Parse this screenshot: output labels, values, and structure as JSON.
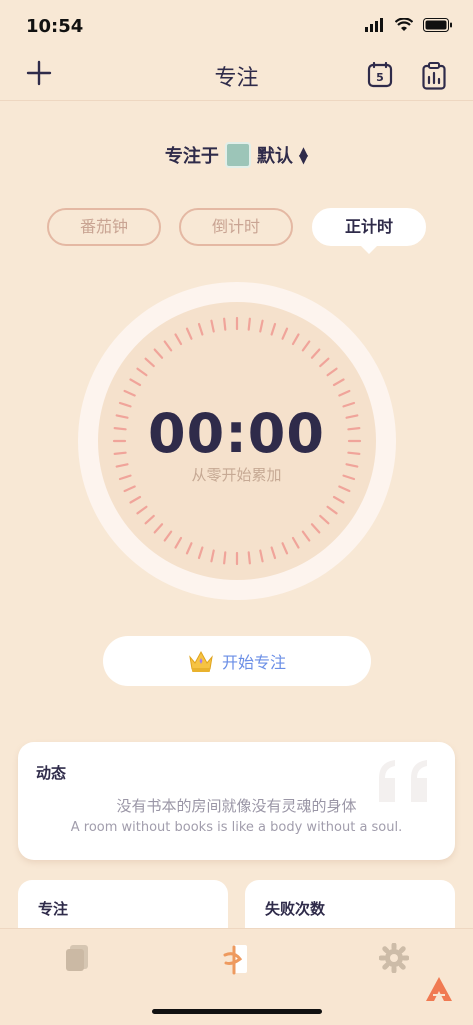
{
  "status": {
    "time": "10:54"
  },
  "nav": {
    "title": "专注",
    "calendar_day": "5"
  },
  "focus_target": {
    "prefix": "专注于",
    "tag": "默认"
  },
  "modes": [
    {
      "label": "番茄钟"
    },
    {
      "label": "倒计时"
    },
    {
      "label": "正计时"
    }
  ],
  "timer": {
    "value": "00:00",
    "subtitle": "从零开始累加"
  },
  "start_button": {
    "label": "开始专注"
  },
  "activity_card": {
    "title": "动态",
    "quote_zh": "没有书本的房间就像没有灵魂的身体",
    "quote_en": "A room without books is like a body without a soul."
  },
  "stat_cards": [
    {
      "title": "专注"
    },
    {
      "title": "失败次数"
    }
  ],
  "colors": {
    "background": "#f8e8d5",
    "accent_blue": "#6a8ee6",
    "tick": "#f0a49a",
    "text_dark": "#2f2b4a"
  }
}
